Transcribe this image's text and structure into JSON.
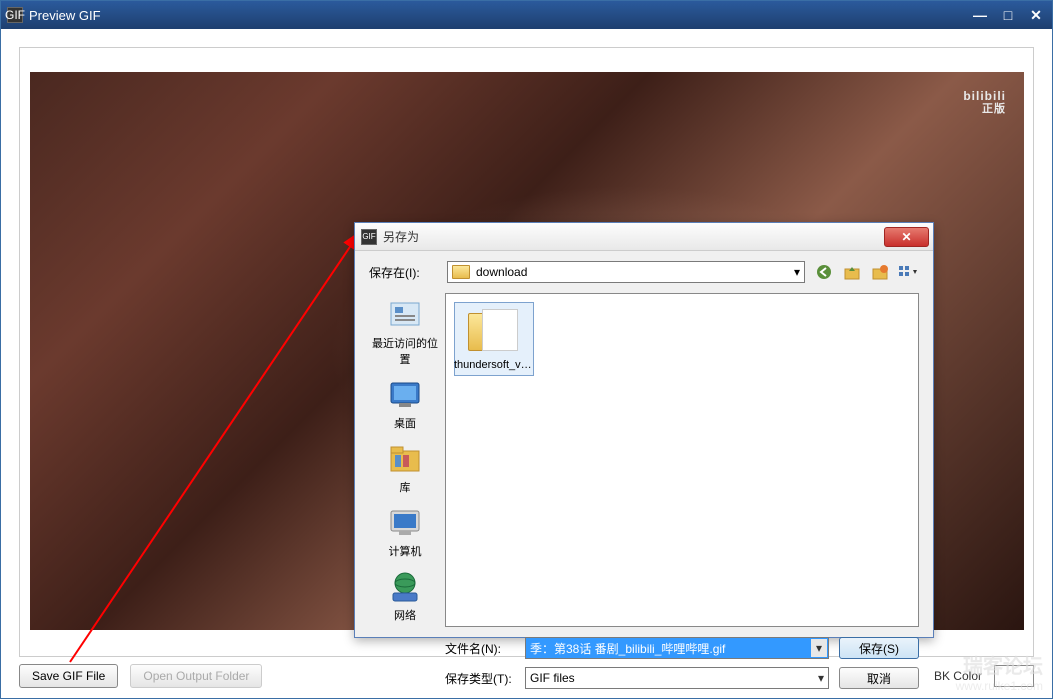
{
  "mainWindow": {
    "title": "Preview GIF",
    "iconText": "GIF"
  },
  "preview": {
    "watermark": "bilibili",
    "watermarkSub": "正版"
  },
  "bottom": {
    "saveBtn": "Save GIF File",
    "openBtn": "Open Output Folder",
    "bkColorLabel": "BK Color"
  },
  "saveDialog": {
    "title": "另存为",
    "saveInLabel": "保存在(I):",
    "location": "download",
    "folder": {
      "name": "thundersoft_vid..."
    },
    "places": {
      "recent": "最近访问的位置",
      "desktop": "桌面",
      "library": "库",
      "computer": "计算机",
      "network": "网络"
    },
    "filenameLabel": "文件名(N):",
    "filenameValue": "季：第38话 番剧_bilibili_哔哩哔哩.gif",
    "filetypeLabel": "保存类型(T):",
    "filetypeValue": "GIF files",
    "saveBtn": "保存(S)",
    "cancelBtn": "取消"
  },
  "forumWatermark": {
    "text": "瑞客论坛",
    "url": "www.ruike1.com"
  }
}
